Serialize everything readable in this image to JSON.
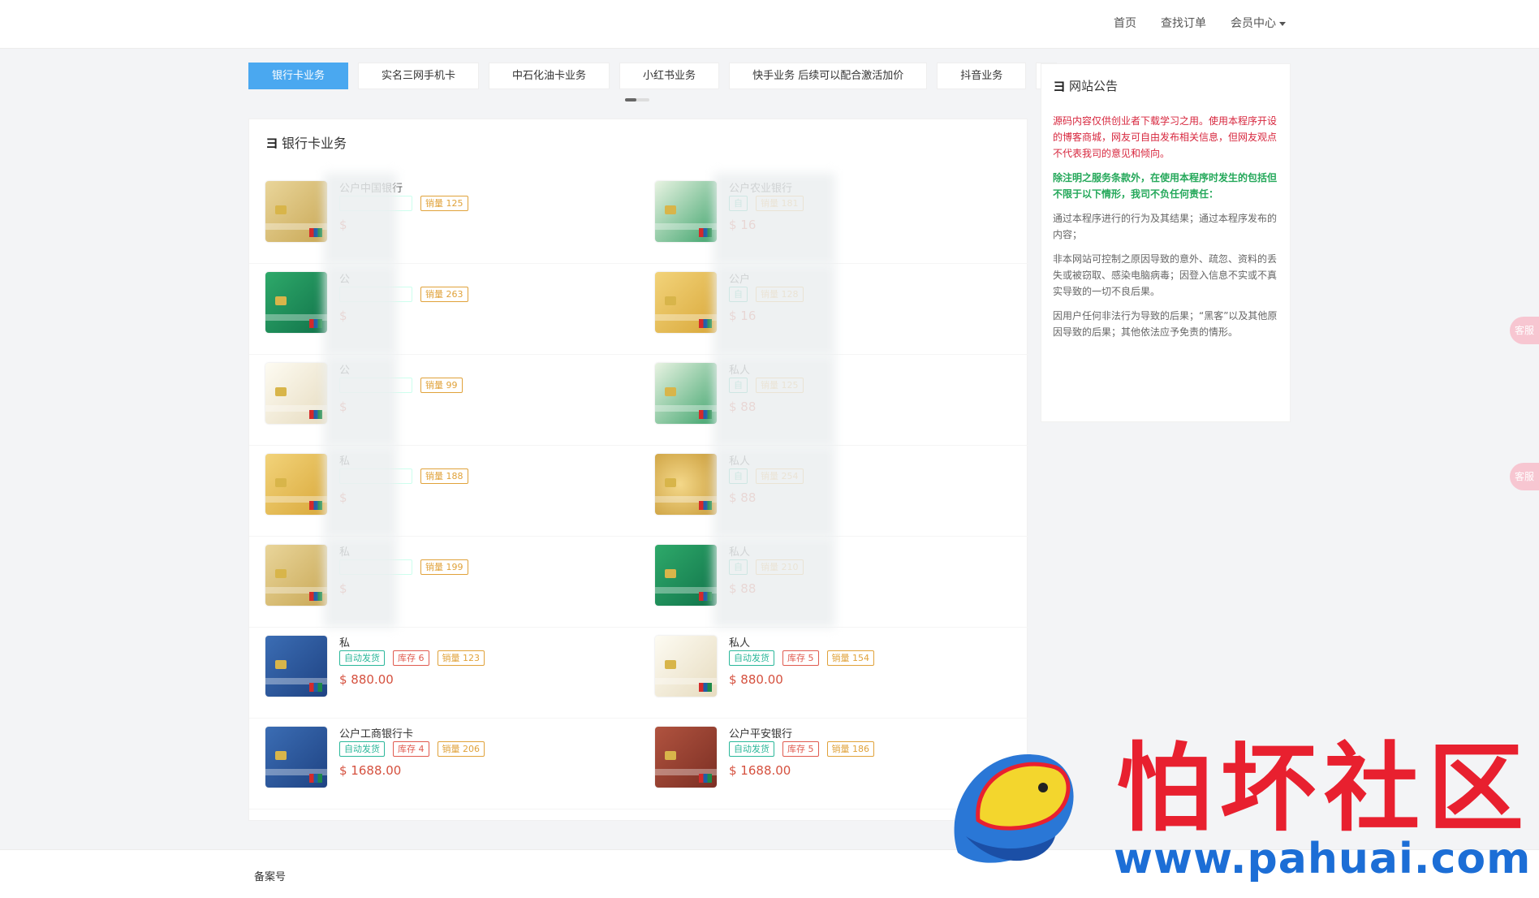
{
  "nav": {
    "home": "首页",
    "orders": "查找订单",
    "member": "会员中心"
  },
  "tabs": [
    "银行卡业务",
    "实名三网手机卡",
    "中石化油卡业务",
    "小红书业务",
    "快手业务 后续可以配合激活加价",
    "抖音业务"
  ],
  "panel": {
    "title": "银行卡业务"
  },
  "items": [
    {
      "name": "公户中国银行",
      "auto": "",
      "stock": "",
      "sales": "销量 125",
      "price": "$",
      "color": "gold"
    },
    {
      "name": "公户农业银行",
      "auto": "自",
      "stock": "",
      "sales": "销量 181",
      "price": "$ 16",
      "color": "lightgreen"
    },
    {
      "name": "公",
      "auto": "",
      "stock": "",
      "sales": "销量 263",
      "price": "$",
      "color": "green"
    },
    {
      "name": "公户",
      "auto": "自",
      "stock": "",
      "sales": "销量 128",
      "price": "$ 16",
      "color": "yellow"
    },
    {
      "name": "公",
      "auto": "",
      "stock": "",
      "sales": "销量 99",
      "price": "$",
      "color": "white"
    },
    {
      "name": "私人",
      "auto": "自",
      "stock": "",
      "sales": "销量 125",
      "price": "$ 88",
      "color": "lightgreen"
    },
    {
      "name": "私",
      "auto": "",
      "stock": "",
      "sales": "销量 188",
      "price": "$",
      "color": "yellow"
    },
    {
      "name": "私人",
      "auto": "自",
      "stock": "",
      "sales": "销量 254",
      "price": "$ 88",
      "color": "coin"
    },
    {
      "name": "私",
      "auto": "",
      "stock": "",
      "sales": "销量 199",
      "price": "$",
      "color": "gold"
    },
    {
      "name": "私人",
      "auto": "自",
      "stock": "",
      "sales": "销量 210",
      "price": "$ 88",
      "color": "green"
    },
    {
      "name": "私",
      "auto": "自动发货",
      "stock": "库存 6",
      "sales": "销量 123",
      "price": "$ 880.00",
      "color": "blue"
    },
    {
      "name": "私人",
      "auto": "自动发货",
      "stock": "库存 5",
      "sales": "销量 154",
      "price": "$ 880.00",
      "color": "white"
    },
    {
      "name": "公户工商银行卡",
      "auto": "自动发货",
      "stock": "库存 4",
      "sales": "销量 206",
      "price": "$ 1688.00",
      "color": "blue"
    },
    {
      "name": "公户平安银行",
      "auto": "自动发货",
      "stock": "库存 5",
      "sales": "销量 186",
      "price": "$ 1688.00",
      "color": "red"
    }
  ],
  "notice": {
    "title": "网站公告",
    "p1": "源码内容仅供创业者下载学习之用。使用本程序开设的博客商城，网友可自由发布相关信息，但网友观点不代表我司的意见和倾向。",
    "p2": "除注明之服务条款外，在使用本程序时发生的包括但不限于以下情形，我司不负任何责任：",
    "p3": "通过本程序进行的行为及其结果；通过本程序发布的内容；",
    "p4": "非本网站可控制之原因导致的意外、疏忽、资料的丢失或被窃取、感染电脑病毒；因登入信息不实或不真实导致的一切不良后果。",
    "p5": "因用户任何非法行为导致的后果；“黑客”以及其他原因导致的后果；其他依法应予免责的情形。"
  },
  "footer": {
    "beian": "备案号"
  },
  "watermark": {
    "brand": "怕坏社区",
    "url": "www.pahuai.com"
  },
  "side": {
    "label": "客服"
  }
}
